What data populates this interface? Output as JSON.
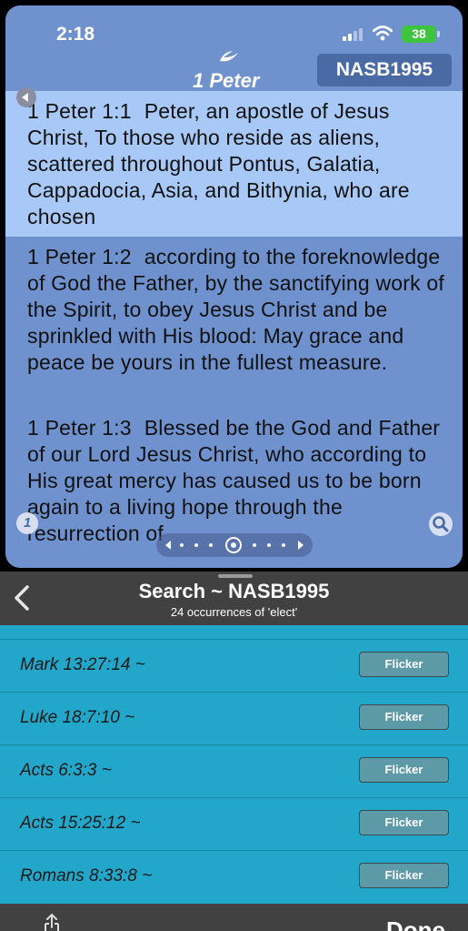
{
  "status_bar": {
    "time": "2:18",
    "battery": "38"
  },
  "header": {
    "book_title": "1 Peter",
    "version": "NASB1995"
  },
  "verses": [
    {
      "ref": "1 Peter 1:1",
      "text": "Peter, an apostle of Jesus Christ, To those who reside as aliens, scattered throughout Pontus, Galatia, Cappadocia, Asia, and Bithynia, who are chosen"
    },
    {
      "ref": "1 Peter 1:2",
      "text": "according to the foreknowledge of God the Father, by the sanctifying work of the Spirit, to obey Jesus Christ and be sprinkled with His blood: May grace and peace be yours in the fullest measure."
    },
    {
      "ref": "1 Peter 1:3",
      "text": "Blessed be the God and Father of our Lord Jesus Christ, who according to His great mercy has caused us to be born again to a living hope through the resurrection of"
    }
  ],
  "chapter_badge": "1",
  "search": {
    "title": "Search ~ NASB1995",
    "subtitle": "24 occurrences of 'elect'",
    "results": [
      {
        "label": "Mark 13:27:14 ~",
        "button": "Flicker"
      },
      {
        "label": "Luke 18:7:10 ~",
        "button": "Flicker"
      },
      {
        "label": "Acts 6:3:3 ~",
        "button": "Flicker"
      },
      {
        "label": "Acts 15:25:12 ~",
        "button": "Flicker"
      },
      {
        "label": "Romans 8:33:8 ~",
        "button": "Flicker"
      }
    ]
  },
  "bottom": {
    "done_label": "Done"
  },
  "colors": {
    "reader_bg": "#6f92cf",
    "selected_verse_bg": "#a8c9f7",
    "results_bg": "#22a6c9",
    "header_bg": "#414141",
    "battery": "#3ec43e"
  }
}
